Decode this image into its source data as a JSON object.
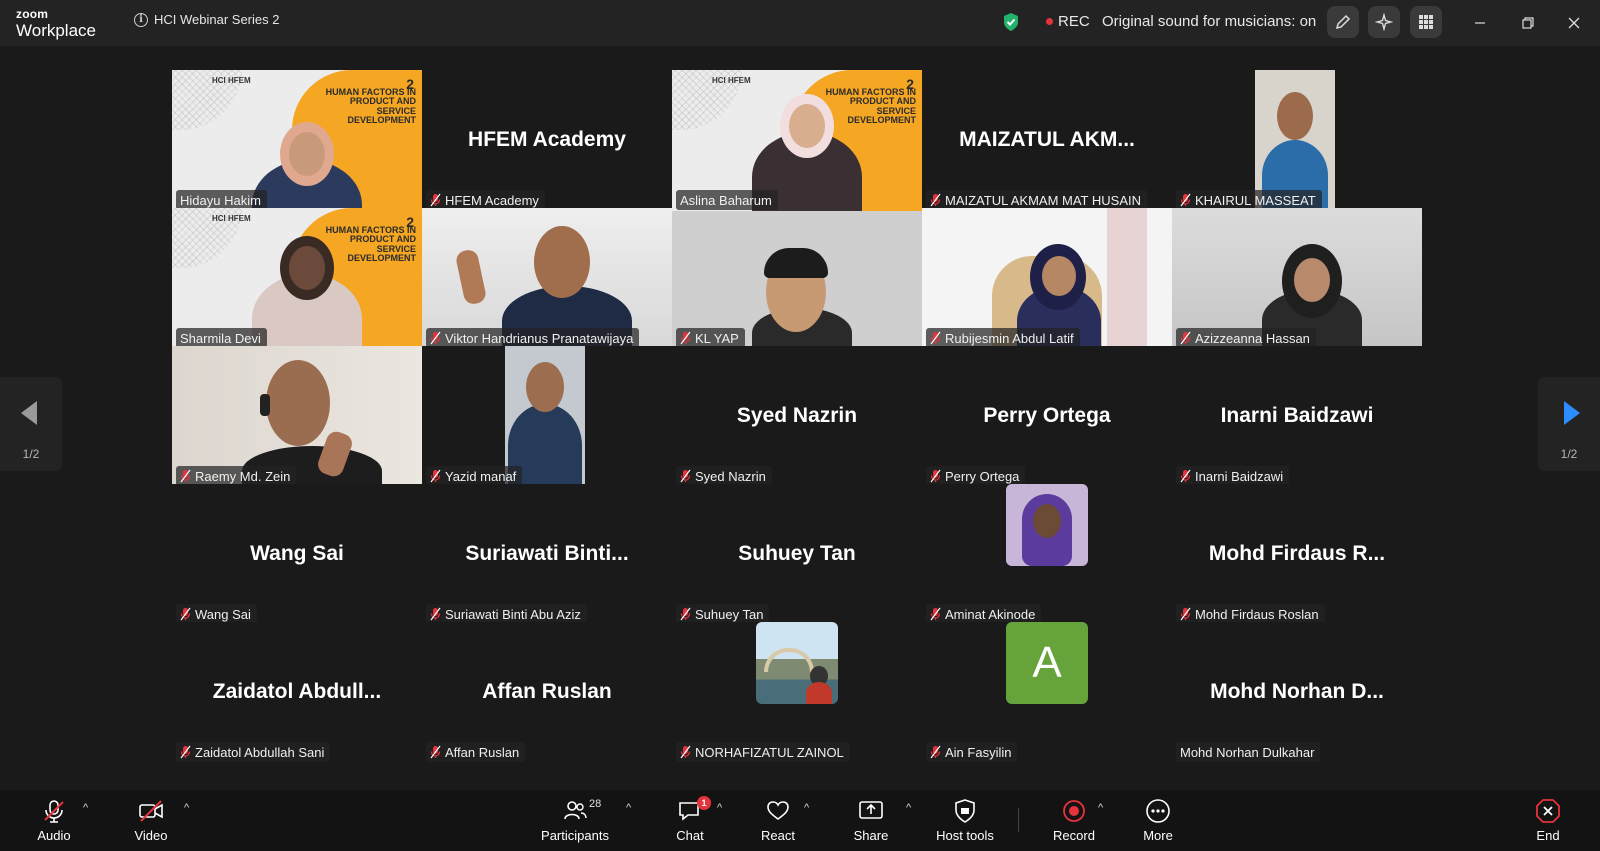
{
  "titlebar": {
    "brand_small": "zoom",
    "brand_big": "Workplace",
    "meeting_title": "HCI Webinar Series 2",
    "rec_label": "REC",
    "sound_status": "Original sound for musicians: on",
    "colors": {
      "shield": "#23b26d",
      "rec": "#e5333b"
    }
  },
  "gallery": {
    "page_indicator": "1/2",
    "poster": {
      "number": "2",
      "title": "HUMAN FACTORS IN PRODUCT AND SERVICE DEVELOPMENT",
      "logos": "HCI  HFEM"
    },
    "tiles": [
      {
        "id": "t0",
        "big_name": "",
        "tag": "Hidayu Hakim",
        "muted": false,
        "video": "poster-woman-orange"
      },
      {
        "id": "t1",
        "big_name": "HFEM Academy",
        "tag": "HFEM Academy",
        "muted": true,
        "video": "none"
      },
      {
        "id": "t2",
        "big_name": "",
        "tag": "Aslina Baharum",
        "muted": false,
        "video": "poster-woman-white",
        "active": true
      },
      {
        "id": "t3",
        "big_name": "MAIZATUL AKM...",
        "tag": "MAIZATUL AKMAM MAT HUSAIN",
        "muted": true,
        "video": "none"
      },
      {
        "id": "t4",
        "big_name": "",
        "tag": "KHAIRUL MASSEAT",
        "muted": true,
        "video": "man-blue-narrow"
      },
      {
        "id": "t5",
        "big_name": "",
        "tag": "Sharmila Devi",
        "muted": false,
        "video": "poster-woman-glasses"
      },
      {
        "id": "t6",
        "big_name": "",
        "tag": "Viktor Handrianus Pranatawijaya",
        "muted": true,
        "video": "man-peace"
      },
      {
        "id": "t7",
        "big_name": "",
        "tag": "KL YAP",
        "muted": true,
        "video": "man-glasses-grey"
      },
      {
        "id": "t8",
        "big_name": "",
        "tag": "Rubijesmin Abdul Latif",
        "muted": true,
        "video": "woman-room"
      },
      {
        "id": "t9",
        "big_name": "",
        "tag": "Azizzeanna Hassan",
        "muted": true,
        "video": "woman-grey"
      },
      {
        "id": "t10",
        "big_name": "",
        "tag": "Raemy Md. Zein",
        "muted": true,
        "video": "man-headset"
      },
      {
        "id": "t11",
        "big_name": "",
        "tag": "Yazid manaf",
        "muted": true,
        "video": "man-narrow"
      },
      {
        "id": "t12",
        "big_name": "Syed Nazrin",
        "tag": "Syed Nazrin",
        "muted": true,
        "video": "none"
      },
      {
        "id": "t13",
        "big_name": "Perry Ortega",
        "tag": "Perry Ortega",
        "muted": true,
        "video": "none"
      },
      {
        "id": "t14",
        "big_name": "Inarni Baidzawi",
        "tag": "Inarni Baidzawi",
        "muted": true,
        "video": "none"
      },
      {
        "id": "t15",
        "big_name": "Wang Sai",
        "tag": "Wang Sai",
        "muted": true,
        "video": "none"
      },
      {
        "id": "t16",
        "big_name": "Suriawati  Binti...",
        "tag": "Suriawati Binti Abu Aziz",
        "muted": true,
        "video": "none"
      },
      {
        "id": "t17",
        "big_name": "Suhuey Tan",
        "tag": "Suhuey Tan",
        "muted": true,
        "video": "none"
      },
      {
        "id": "t18",
        "big_name": "",
        "tag": "Aminat Akinode",
        "muted": true,
        "video": "avatar-purple"
      },
      {
        "id": "t19",
        "big_name": "Mohd Firdaus R...",
        "tag": "Mohd Firdaus Roslan",
        "muted": true,
        "video": "none"
      },
      {
        "id": "t20",
        "big_name": "Zaidatol  Abdull...",
        "tag": "Zaidatol Abdullah Sani",
        "muted": true,
        "video": "none"
      },
      {
        "id": "t21",
        "big_name": "Affan Ruslan",
        "tag": "Affan Ruslan",
        "muted": true,
        "video": "none"
      },
      {
        "id": "t22",
        "big_name": "",
        "tag": "NORHAFIZATUL ZAINOL",
        "muted": true,
        "video": "avatar-bridge"
      },
      {
        "id": "t23",
        "big_name": "",
        "tag": "Ain Fasyilin",
        "muted": true,
        "video": "avatar-letter",
        "letter": "A"
      },
      {
        "id": "t24",
        "big_name": "Mohd Norhan D...",
        "tag": "Mohd Norhan Dulkahar",
        "muted": false,
        "video": "none"
      }
    ]
  },
  "toolbar": {
    "audio": "Audio",
    "video": "Video",
    "participants": "Participants",
    "participants_count": "28",
    "chat": "Chat",
    "chat_badge": "1",
    "react": "React",
    "share": "Share",
    "host_tools": "Host tools",
    "record": "Record",
    "more": "More",
    "end": "End",
    "colors": {
      "end": "#e5333b",
      "record": "#e5333b",
      "letter_avatar": "#66a33b"
    }
  }
}
